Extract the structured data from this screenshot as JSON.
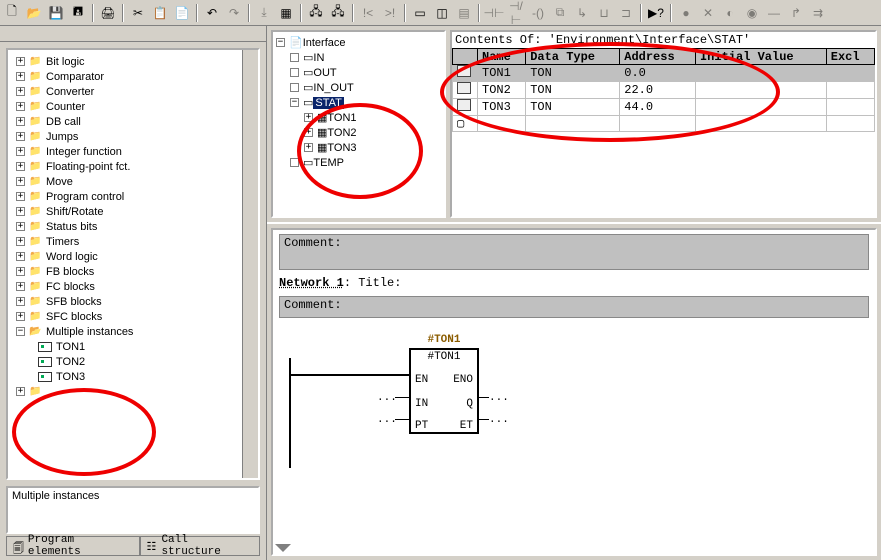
{
  "toolbar": {
    "new": "new",
    "open": "open",
    "save": "save",
    "saveall": "saveall",
    "print": "print",
    "cut": "cut",
    "copy": "copy",
    "paste": "paste",
    "undo": "undo",
    "redo": "redo"
  },
  "left": {
    "categories": [
      "Bit logic",
      "Comparator",
      "Converter",
      "Counter",
      "DB call",
      "Jumps",
      "Integer function",
      "Floating-point fct.",
      "Move",
      "Program control",
      "Shift/Rotate",
      "Status bits",
      "Timers",
      "Word logic",
      "FB blocks",
      "FC blocks",
      "SFB blocks",
      "SFC blocks",
      "Multiple instances"
    ],
    "mi_children": [
      "TON1",
      "TON2",
      "TON3"
    ],
    "mi_footer": "Multiple instances",
    "tab1": "Program elements",
    "tab2": "Call structure"
  },
  "iface": {
    "root": "Interface",
    "items": [
      "IN",
      "OUT",
      "IN_OUT",
      "STAT"
    ],
    "stat_children": [
      "TON1",
      "TON2",
      "TON3"
    ],
    "temp": "TEMP"
  },
  "vartable": {
    "path": "Contents Of: 'Environment\\Interface\\STAT'",
    "cols": [
      "Name",
      "Data Type",
      "Address",
      "Initial Value",
      "Excl"
    ],
    "rows": [
      {
        "name": "TON1",
        "type": "TON",
        "addr": "0.0"
      },
      {
        "name": "TON2",
        "type": "TON",
        "addr": "22.0"
      },
      {
        "name": "TON3",
        "type": "TON",
        "addr": "44.0"
      }
    ]
  },
  "editor": {
    "comment_label": "Comment:",
    "network_label": "Network 1",
    "title_suffix": ": Title:",
    "fb_outer": "#TON1",
    "fb_inner": "#TON1",
    "pins": {
      "EN": "EN",
      "ENO": "ENO",
      "IN": "IN",
      "Q": "Q",
      "PT": "PT",
      "ET": "ET"
    },
    "dots": "..."
  }
}
